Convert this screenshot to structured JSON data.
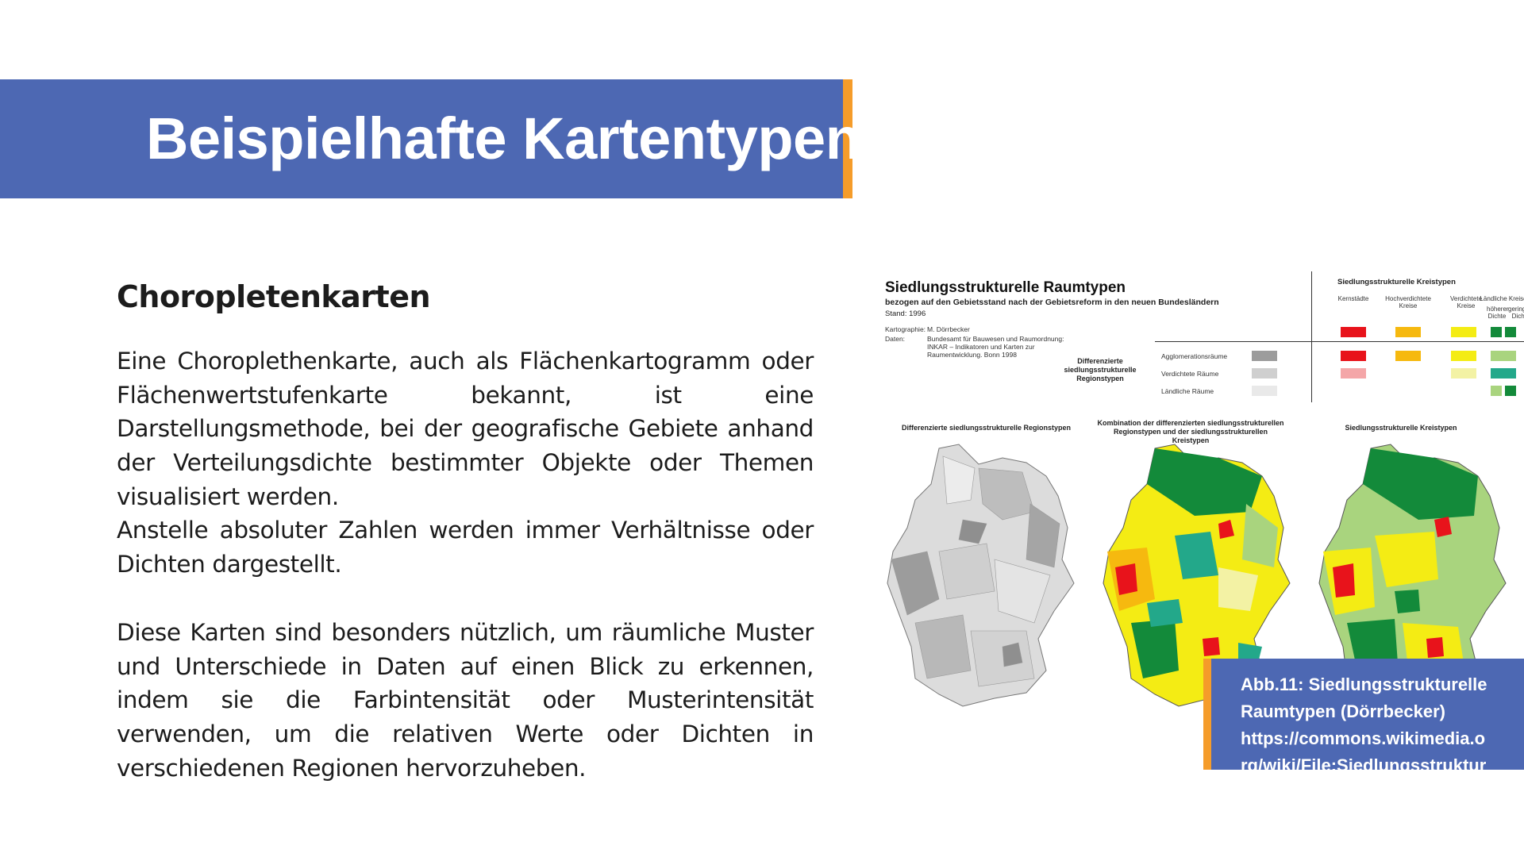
{
  "slide": {
    "title": "Beispielhafte Kartentypen",
    "section_heading": "Choropletenkarten",
    "paragraphs": [
      "Eine Choroplethenkarte, auch als Flächenkartogramm oder Flächenwertstufenkarte bekannt, ist eine Darstellungsmethode, bei der geografische Gebiete anhand der Verteilungsdichte bestimmter Objekte oder Themen visualisiert werden.",
      "Anstelle absoluter Zahlen werden immer Verhältnisse oder Dichten dargestellt.",
      "Diese Karten sind besonders nützlich, um räumliche Muster und Unterschiede in Daten auf einen Blick zu erkennen, indem sie die Farbintensität oder Musterintensität verwenden, um die relativen Werte oder Dichten in verschiedenen Regionen hervorzuheben."
    ]
  },
  "figure": {
    "title": "Siedlungsstrukturelle Raumtypen",
    "subtitle": "bezogen auf den Gebietsstand nach der Gebietsreform in den neuen Bundesländern",
    "stand": "Stand: 1996",
    "kartographie_label": "Kartographie:",
    "kartographie_value": "M. Dörrbecker",
    "daten_label": "Daten:",
    "daten_value": "Bundesamt für Bauwesen und Raumordnung: INKAR – Indikatoren und Karten zur Raumentwicklung. Bonn 1998",
    "diff_label": "Differenzierte siedlungsstrukturelle Regionstypen",
    "legend": {
      "title": "Siedlungsstrukturelle Kreistypen",
      "columns": [
        "Kernstädte",
        "Hochverdichtete Kreise",
        "Verdichtete Kreise",
        "Ländliche Kreise"
      ],
      "sub_columns": [
        "höherer Dichte",
        "geringerer Dichte"
      ],
      "rows": [
        "Agglomerationsräume",
        "Verdichtete Räume",
        "Ländliche Räume"
      ],
      "colors": {
        "red": "#e8131b",
        "pink": "#f4a6a8",
        "orange": "#f6b90f",
        "yellow": "#f4ec14",
        "light_yellow": "#f3f2a4",
        "light_green": "#a9d47e",
        "teal": "#23a88a",
        "dark_green": "#138a3a",
        "gray_dark": "#9c9c9c",
        "gray_mid": "#cfcfcf",
        "gray_light": "#e9e9e9"
      }
    },
    "map_captions": [
      "Differenzierte siedlungsstrukturelle Regionstypen",
      "Kombination der differenzierten siedlungsstrukturellen Regionstypen und der siedlungsstrukturellen Kreistypen",
      "Siedlungsstrukturelle Kreistypen"
    ],
    "caption_lines": [
      "Abb.11: Siedlungsstrukturelle",
      "Raumtypen (Dörrbecker)",
      "https://commons.wikimedia.o",
      "rg/wiki/File:Siedlungsstruktur"
    ]
  }
}
